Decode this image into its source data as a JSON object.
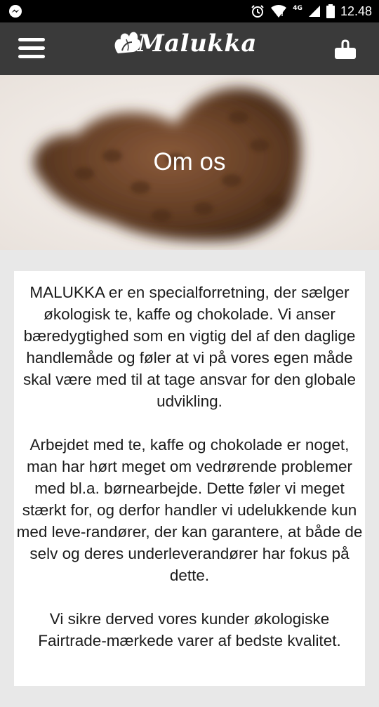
{
  "status": {
    "time": "12.48",
    "network": "4G"
  },
  "header": {
    "brand": "Malukka",
    "menu_icon": "hamburger-menu-icon",
    "cart_icon": "shopping-basket-icon"
  },
  "hero": {
    "title": "Om os"
  },
  "content": {
    "paragraph_1": "MALUKKA er en specialforretning, der sælger økologisk te, kaffe og chokolade. Vi anser bæredygtighed som en vigtig del af den daglige handlemåde og føler at vi på vores egen måde skal være med til at tage ansvar for den globale udvikling.",
    "paragraph_2": "Arbejdet med te, kaffe og chokolade er noget, man har hørt meget om vedrørende problemer med bl.a. børnearbejde. Dette føler vi meget stærkt for, og derfor handler vi udelukkende kun med leve-randører, der kan garantere, at både de selv og deres underleverandører har fokus på dette.",
    "paragraph_3": "Vi sikre derved vores kunder økologiske Fairtrade-mærkede varer af bedste kvalitet."
  },
  "colors": {
    "header_bg": "#3a3a3a",
    "statusbar_bg": "#000000",
    "page_bg": "#e8e8e8",
    "card_bg": "#ffffff"
  }
}
